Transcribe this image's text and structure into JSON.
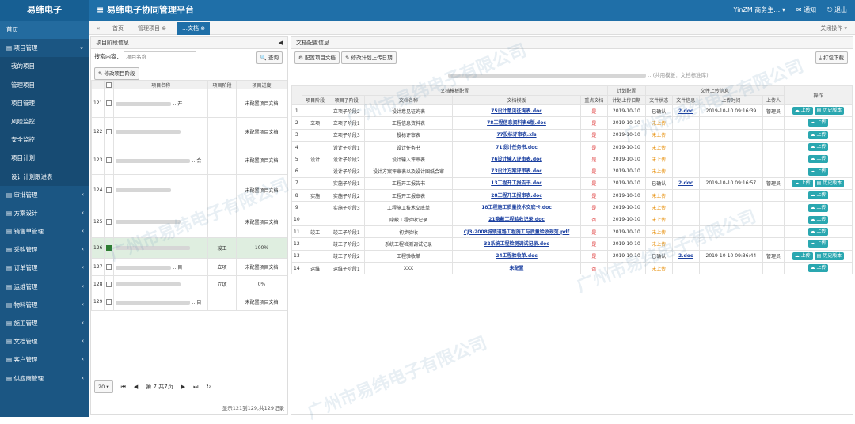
{
  "app": {
    "brand": "易纬电子",
    "platform": "≡ 易纬电子协同管理平台",
    "user": "YinZM 商务主… ▾",
    "notify": "通知",
    "logout": "退出"
  },
  "sidebar": [
    {
      "label": "首页",
      "kind": "home"
    },
    {
      "label": "项目管理",
      "kind": "group",
      "arrow": "⌄"
    },
    {
      "label": "我的项目",
      "kind": "sub"
    },
    {
      "label": "管理项目",
      "kind": "sub"
    },
    {
      "label": "项目管理",
      "kind": "sub"
    },
    {
      "label": "风险监控",
      "kind": "sub"
    },
    {
      "label": "安全监控",
      "kind": "sub"
    },
    {
      "label": "项目计划",
      "kind": "sub"
    },
    {
      "label": "设计计划跟进表",
      "kind": "sub"
    },
    {
      "label": "审批管理",
      "kind": "group",
      "arrow": "‹"
    },
    {
      "label": "方案设计",
      "kind": "group",
      "arrow": "‹"
    },
    {
      "label": "销售单管理",
      "kind": "group",
      "arrow": "‹"
    },
    {
      "label": "采购管理",
      "kind": "group",
      "arrow": "‹"
    },
    {
      "label": "订单管理",
      "kind": "group",
      "arrow": "‹"
    },
    {
      "label": "运维管理",
      "kind": "group",
      "arrow": "‹"
    },
    {
      "label": "物料管理",
      "kind": "group",
      "arrow": "‹"
    },
    {
      "label": "施工管理",
      "kind": "group",
      "arrow": "‹"
    },
    {
      "label": "文档管理",
      "kind": "group",
      "arrow": "‹"
    },
    {
      "label": "客户管理",
      "kind": "group",
      "arrow": "‹"
    },
    {
      "label": "供应商管理",
      "kind": "group",
      "arrow": "‹"
    }
  ],
  "tabs": {
    "home": "首页",
    "manage": "管理项目",
    "current": "…文档",
    "close_ops": "关闭操作 ▾"
  },
  "left": {
    "title": "项目阶段信息",
    "search_label": "搜索内容：",
    "search_placeholder": "项目名称",
    "query_btn": "查询",
    "modify_btn": "修改项目阶段",
    "headers": [
      "",
      "",
      "项目名称",
      "项目阶段",
      "项目进度"
    ],
    "rows": [
      {
        "num": "121",
        "name": "…开",
        "stage": "",
        "progress": "未配置项目文档",
        "checked": false,
        "sel": false
      },
      {
        "num": "122",
        "name": "",
        "stage": "",
        "progress": "未配置项目文档",
        "checked": false,
        "sel": false
      },
      {
        "num": "123",
        "name": "…会",
        "stage": "",
        "progress": "未配置项目文档",
        "checked": false,
        "sel": false
      },
      {
        "num": "124",
        "name": "",
        "stage": "",
        "progress": "未配置项目文档",
        "checked": false,
        "sel": false
      },
      {
        "num": "125",
        "name": "",
        "stage": "",
        "progress": "未配置项目文档",
        "checked": false,
        "sel": false
      },
      {
        "num": "126",
        "name": "",
        "stage": "竣工",
        "progress": "100%",
        "checked": true,
        "sel": true
      },
      {
        "num": "127",
        "name": "…目",
        "stage": "立项",
        "progress": "未配置项目文档",
        "checked": false,
        "sel": false
      },
      {
        "num": "128",
        "name": "",
        "stage": "立项",
        "progress": "0%",
        "checked": false,
        "sel": false
      },
      {
        "num": "129",
        "name": "…目",
        "stage": "",
        "progress": "未配置项目文档",
        "checked": false,
        "sel": false
      }
    ],
    "pager": {
      "size": "20 ▾",
      "page_label": "第",
      "page": "7",
      "total_pages": "共7页"
    },
    "summary": "显示121到129,共129记录"
  },
  "right": {
    "title": "文档配置信息",
    "btn_config": "配置项目文档",
    "btn_edit": "修改计划上传日期",
    "btn_pack": "打包下载",
    "project_line": "…(共用模板：文档标准库)",
    "group_template": "文档模板配置",
    "group_plan": "计划配置",
    "group_upload": "文件上传信息",
    "headers": [
      "",
      "项目阶段",
      "项目子阶段",
      "文档名称",
      "文档模板",
      "重点文档",
      "计划上传日期",
      "文件状态",
      "文件信息",
      "上传时间",
      "上传人",
      "操作"
    ],
    "rows": [
      {
        "n": "1",
        "stage": "",
        "sub": "立项子阶段2",
        "doc": "设计意见征询表",
        "tpl": "75设计意见征询表.doc",
        "key": "是",
        "date": "2019-10-10",
        "status": "已确认",
        "file": "2.doc",
        "time": "2019-10-10 09:16:39",
        "user": "管理员",
        "hist": true
      },
      {
        "n": "2",
        "stage": "立项",
        "sub": "立项子阶段1",
        "doc": "工程信息资料表",
        "tpl": "78工程信息资料表6版.doc",
        "key": "是",
        "date": "2019-10-10",
        "status": "未上传",
        "file": "",
        "time": "",
        "user": "",
        "hist": false
      },
      {
        "n": "3",
        "stage": "",
        "sub": "立项子阶段3",
        "doc": "投标评审表",
        "tpl": "77投标评审表.xls",
        "key": "是",
        "date": "2019-10-10",
        "status": "未上传",
        "file": "",
        "time": "",
        "user": "",
        "hist": false
      },
      {
        "n": "4",
        "stage": "",
        "sub": "设计子阶段1",
        "doc": "设计任务书",
        "tpl": "71设计任务书.doc",
        "key": "是",
        "date": "2019-10-10",
        "status": "未上传",
        "file": "",
        "time": "",
        "user": "",
        "hist": false
      },
      {
        "n": "5",
        "stage": "设计",
        "sub": "设计子阶段2",
        "doc": "设计输入评审表",
        "tpl": "76设计输入评审表.doc",
        "key": "是",
        "date": "2019-10-10",
        "status": "未上传",
        "file": "",
        "time": "",
        "user": "",
        "hist": false
      },
      {
        "n": "6",
        "stage": "",
        "sub": "设计子阶段3",
        "doc": "设计方案评审表以及设计图纸会审",
        "tpl": "73设计方案评审表.doc",
        "key": "是",
        "date": "2019-10-10",
        "status": "未上传",
        "file": "",
        "time": "",
        "user": "",
        "hist": false
      },
      {
        "n": "7",
        "stage": "",
        "sub": "实施子阶段1",
        "doc": "工程开工报告书",
        "tpl": "13工程开工报告书.doc",
        "key": "是",
        "date": "2019-10-10",
        "status": "已确认",
        "file": "2.doc",
        "time": "2019-10-10 09:16:57",
        "user": "管理员",
        "hist": true
      },
      {
        "n": "8",
        "stage": "实施",
        "sub": "实施子阶段2",
        "doc": "工程开工报审表",
        "tpl": "28工程开工报审表.doc",
        "key": "是",
        "date": "2019-10-10",
        "status": "未上传",
        "file": "",
        "time": "",
        "user": "",
        "hist": false
      },
      {
        "n": "9",
        "stage": "",
        "sub": "实施子阶段3",
        "doc": "工程施工技术交底单",
        "tpl": "18工程施工质量技术交底卡.doc",
        "key": "是",
        "date": "2019-10-10",
        "status": "未上传",
        "file": "",
        "time": "",
        "user": "",
        "hist": false
      },
      {
        "n": "10",
        "stage": "",
        "sub": "",
        "doc": "隐蔽工程验收记录",
        "tpl": "21隐蔽工程验收记录.doc",
        "key": "否",
        "date": "2019-10-10",
        "status": "未上传",
        "file": "",
        "time": "",
        "user": "",
        "hist": false
      },
      {
        "n": "11",
        "stage": "竣工",
        "sub": "竣工子阶段1",
        "doc": "初步验收",
        "tpl": "CJ3-2008城镇道路工程施工与质量验收规范.pdf",
        "key": "是",
        "date": "2019-10-10",
        "status": "未上传",
        "file": "",
        "time": "",
        "user": "",
        "hist": false
      },
      {
        "n": "12",
        "stage": "",
        "sub": "竣工子阶段3",
        "doc": "系统工程检测调试记录",
        "tpl": "32系统工程检测调试记录.doc",
        "key": "是",
        "date": "2019-10-10",
        "status": "未上传",
        "file": "",
        "time": "",
        "user": "",
        "hist": false
      },
      {
        "n": "13",
        "stage": "",
        "sub": "竣工子阶段2",
        "doc": "工程验收单",
        "tpl": "24工程验收单.doc",
        "key": "是",
        "date": "2019-10-10",
        "status": "已确认",
        "file": "2.doc",
        "time": "2019-10-10 09:36:44",
        "user": "管理员",
        "hist": true
      },
      {
        "n": "14",
        "stage": "运维",
        "sub": "运维子阶段1",
        "doc": "XXX",
        "tpl": "未配置",
        "key": "否",
        "date": "",
        "status": "未上传",
        "file": "",
        "time": "",
        "user": "",
        "hist": false
      }
    ],
    "upload_label": "上传",
    "history_label": "历史版本"
  },
  "watermark": "广州市易纬电子有限公司"
}
